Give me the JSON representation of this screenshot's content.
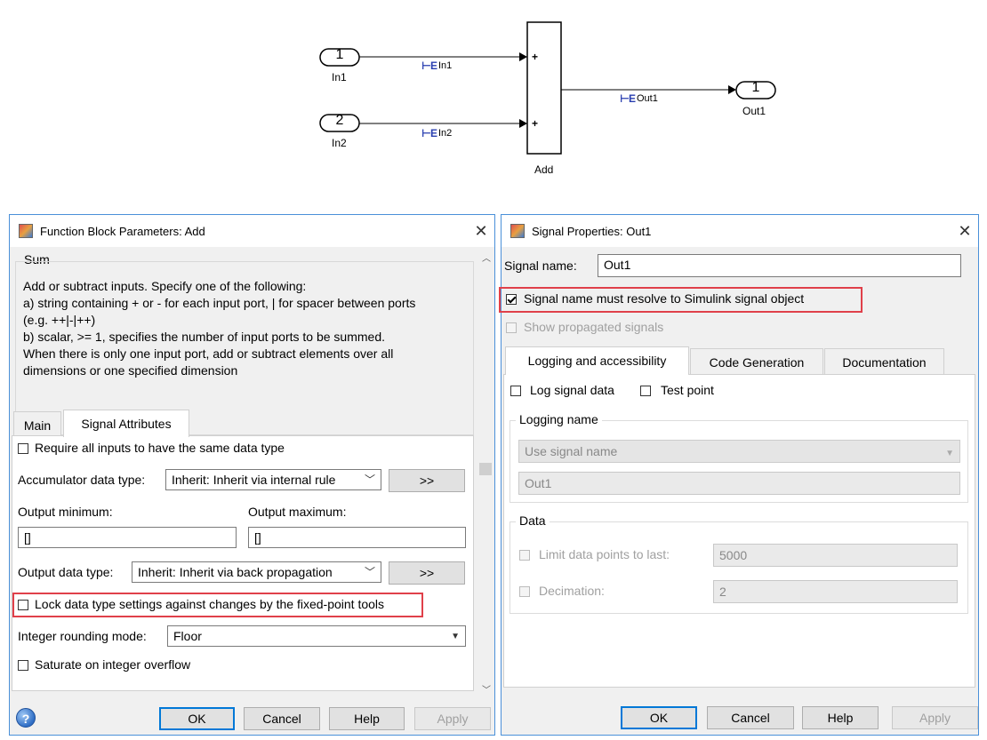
{
  "diagram": {
    "in1": {
      "port": "1",
      "label": "In1",
      "signal": "In1"
    },
    "in2": {
      "port": "2",
      "label": "In2",
      "signal": "In2"
    },
    "add": {
      "label": "Add",
      "plus": "+"
    },
    "out1": {
      "port": "1",
      "label": "Out1",
      "signal": "Out1"
    },
    "resolve_glyph": "⊢E"
  },
  "fbp": {
    "title": "Function Block Parameters: Add",
    "block_type": "Sum",
    "description_lines": [
      "Add or subtract inputs.  Specify one of the following:",
      "a) string containing + or - for each input port, | for spacer between ports",
      "(e.g. ++|-|++)",
      "b) scalar, >= 1, specifies the number of input ports to be summed.",
      "When there is only one input port, add or subtract elements over all",
      "dimensions or one specified dimension"
    ],
    "tabs": [
      {
        "label": "Main"
      },
      {
        "label": "Signal Attributes"
      }
    ],
    "require_same_type_label": "Require all inputs to have the same data type",
    "accum_label": "Accumulator data type:",
    "accum_value": "Inherit: Inherit via internal rule",
    "assist_label": ">>",
    "out_min_label": "Output minimum:",
    "out_min_value": "[]",
    "out_max_label": "Output maximum:",
    "out_max_value": "[]",
    "out_type_label": "Output data type:",
    "out_type_value": "Inherit: Inherit via back propagation",
    "lock_label": "Lock data type settings against changes by the fixed-point tools",
    "rounding_label": "Integer rounding mode:",
    "rounding_value": "Floor",
    "saturate_label": "Saturate on integer overflow",
    "buttons": {
      "ok": "OK",
      "cancel": "Cancel",
      "help": "Help",
      "apply": "Apply"
    },
    "help_glyph": "?",
    "close_glyph": "✕"
  },
  "sp": {
    "title": "Signal Properties: Out1",
    "signal_name_label": "Signal name:",
    "signal_name_value": "Out1",
    "resolve_label": "Signal name must resolve to Simulink signal object",
    "show_prop_label": "Show propagated signals",
    "tabs": [
      {
        "label": "Logging and accessibility"
      },
      {
        "label": "Code Generation"
      },
      {
        "label": "Documentation"
      }
    ],
    "log_label": "Log signal data",
    "test_point_label": "Test point",
    "logging_name_group": "Logging name",
    "logging_name_mode": "Use signal name",
    "logging_name_value": "Out1",
    "data_group": "Data",
    "limit_label": "Limit data points to last:",
    "limit_value": "5000",
    "decimation_label": "Decimation:",
    "decimation_value": "2",
    "buttons": {
      "ok": "OK",
      "cancel": "Cancel",
      "help": "Help",
      "apply": "Apply"
    },
    "close_glyph": "✕"
  }
}
